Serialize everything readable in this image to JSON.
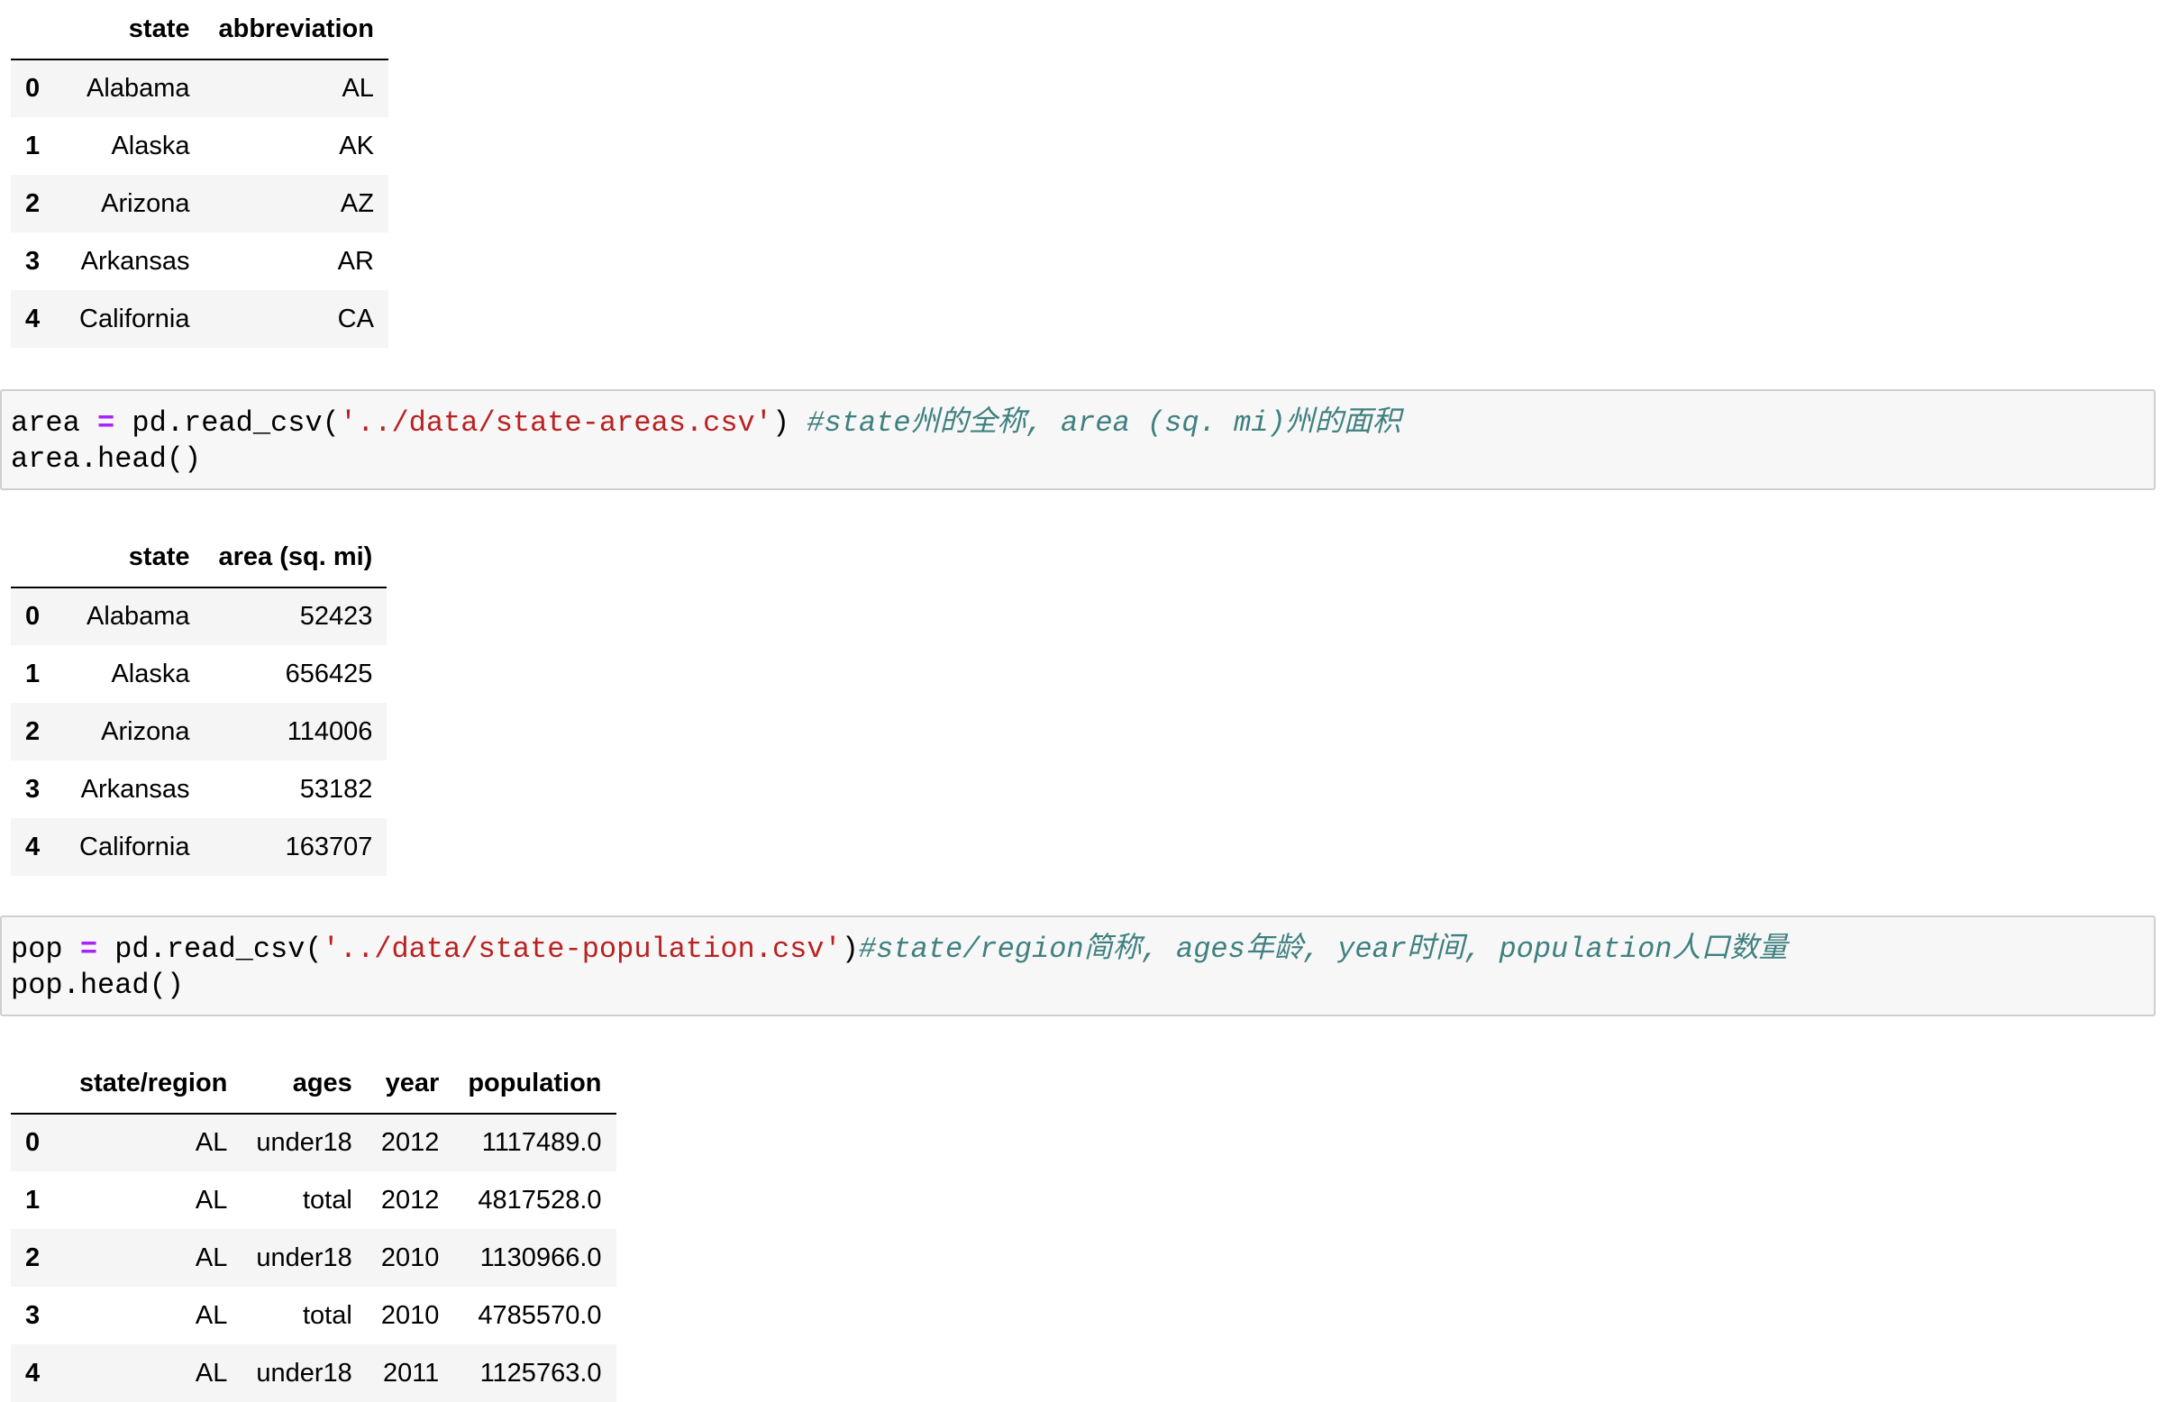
{
  "table1": {
    "columns": [
      "",
      "state",
      "abbreviation"
    ],
    "rows": [
      {
        "index": "0",
        "state": "Alabama",
        "abbreviation": "AL"
      },
      {
        "index": "1",
        "state": "Alaska",
        "abbreviation": "AK"
      },
      {
        "index": "2",
        "state": "Arizona",
        "abbreviation": "AZ"
      },
      {
        "index": "3",
        "state": "Arkansas",
        "abbreviation": "AR"
      },
      {
        "index": "4",
        "state": "California",
        "abbreviation": "CA"
      }
    ]
  },
  "cell_area": {
    "line1": {
      "var": "area",
      "op": "=",
      "call": "pd.read_csv(",
      "str": "'../data/state-areas.csv'",
      "close": ")",
      "comment": "#state州的全称, area (sq. mi)州的面积"
    },
    "line2": "area.head()"
  },
  "table2": {
    "columns": [
      "",
      "state",
      "area (sq. mi)"
    ],
    "rows": [
      {
        "index": "0",
        "state": "Alabama",
        "area": "52423"
      },
      {
        "index": "1",
        "state": "Alaska",
        "area": "656425"
      },
      {
        "index": "2",
        "state": "Arizona",
        "area": "114006"
      },
      {
        "index": "3",
        "state": "Arkansas",
        "area": "53182"
      },
      {
        "index": "4",
        "state": "California",
        "area": "163707"
      }
    ]
  },
  "cell_pop": {
    "line1": {
      "var": "pop",
      "op": "=",
      "call": "pd.read_csv(",
      "str": "'../data/state-population.csv'",
      "close": ")",
      "comment": "#state/region简称, ages年龄, year时间, population人口数量"
    },
    "line2": "pop.head()"
  },
  "table3": {
    "columns": [
      "",
      "state/region",
      "ages",
      "year",
      "population"
    ],
    "rows": [
      {
        "index": "0",
        "region": "AL",
        "ages": "under18",
        "year": "2012",
        "population": "1117489.0"
      },
      {
        "index": "1",
        "region": "AL",
        "ages": "total",
        "year": "2012",
        "population": "4817528.0"
      },
      {
        "index": "2",
        "region": "AL",
        "ages": "under18",
        "year": "2010",
        "population": "1130966.0"
      },
      {
        "index": "3",
        "region": "AL",
        "ages": "total",
        "year": "2010",
        "population": "4785570.0"
      },
      {
        "index": "4",
        "region": "AL",
        "ages": "under18",
        "year": "2011",
        "population": "1125763.0"
      }
    ]
  }
}
